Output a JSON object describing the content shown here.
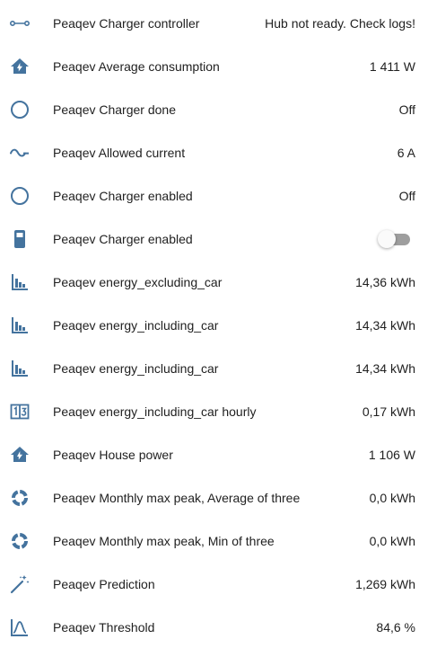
{
  "colors": {
    "icon": "#44739e",
    "text": "#212121",
    "toggle_track": "#9e9e9e",
    "toggle_thumb": "#fafafa"
  },
  "entities": [
    {
      "icon": "ray-start-end-icon",
      "name": "Peaqev Charger controller",
      "value": "Hub not ready. Check logs!"
    },
    {
      "icon": "home-lightning-bolt-icon",
      "name": "Peaqev Average consumption",
      "value": "1 411 W"
    },
    {
      "icon": "circle-outline-icon",
      "name": "Peaqev Charger done",
      "value": "Off"
    },
    {
      "icon": "sine-wave-icon",
      "name": "Peaqev Allowed current",
      "value": "6 A"
    },
    {
      "icon": "circle-outline-icon",
      "name": "Peaqev Charger enabled",
      "value": "Off"
    },
    {
      "icon": "ev-station-icon",
      "name": "Peaqev Charger enabled",
      "toggle": "off"
    },
    {
      "icon": "chart-histogram-icon",
      "name": "Peaqev energy_excluding_car",
      "value": "14,36 kWh"
    },
    {
      "icon": "chart-histogram-icon",
      "name": "Peaqev energy_including_car",
      "value": "14,34 kWh"
    },
    {
      "icon": "chart-histogram-icon",
      "name": "Peaqev energy_including_car",
      "value": "14,34 kWh"
    },
    {
      "icon": "counter-icon",
      "name": "Peaqev energy_including_car hourly",
      "value": "0,17 kWh"
    },
    {
      "icon": "home-lightning-bolt-icon",
      "name": "Peaqev House power",
      "value": "1 106 W"
    },
    {
      "icon": "chart-donut-icon",
      "name": "Peaqev Monthly max peak, Average of three",
      "value": "0,0 kWh"
    },
    {
      "icon": "chart-donut-icon",
      "name": "Peaqev Monthly max peak, Min of three",
      "value": "0,0 kWh"
    },
    {
      "icon": "magic-wand-icon",
      "name": "Peaqev Prediction",
      "value": "1,269 kWh"
    },
    {
      "icon": "chart-bell-curve-icon",
      "name": "Peaqev Threshold",
      "value": "84,6 %"
    }
  ]
}
